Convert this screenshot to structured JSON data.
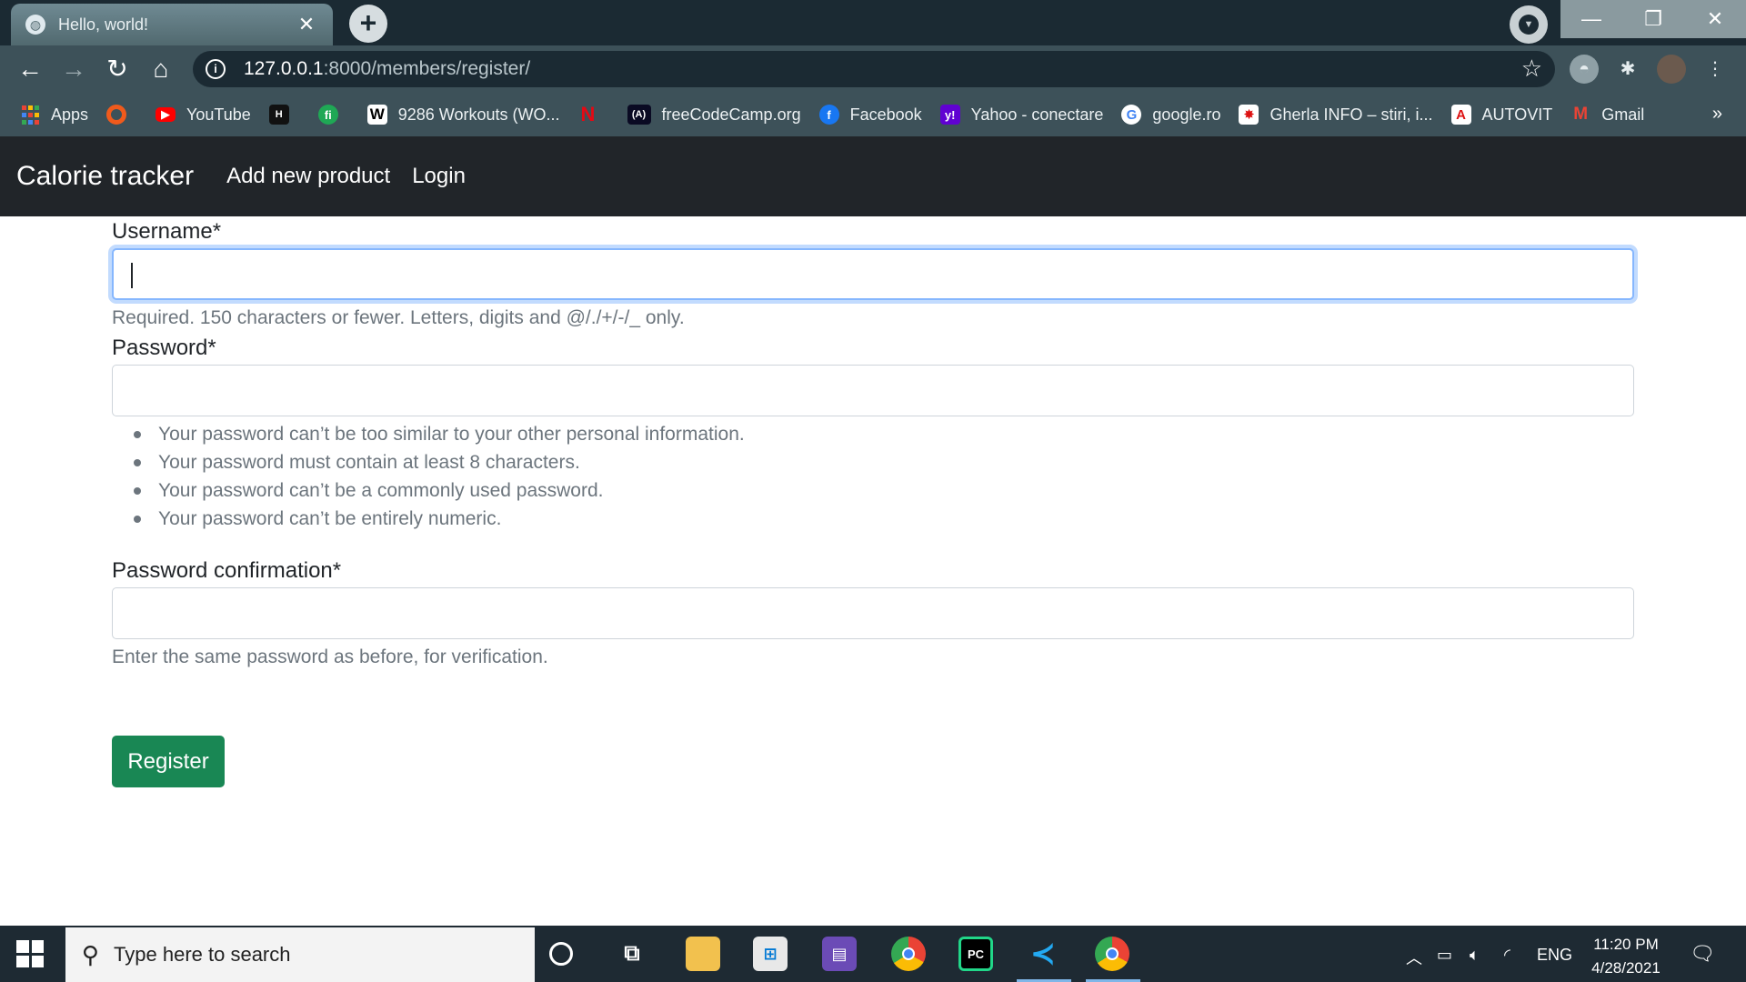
{
  "browser": {
    "tab_title": "Hello, world!",
    "tab_close": "✕",
    "new_tab": "+",
    "url_host": "127.0.0.1",
    "url_path": ":8000/members/register/",
    "window_controls": {
      "minimize": "—",
      "restore": "❐",
      "close": "✕"
    },
    "bookmarks": [
      {
        "label": "Apps",
        "icon": "apps-grid-icon"
      },
      {
        "label": "",
        "icon": "orange-ring-icon"
      },
      {
        "label": "YouTube",
        "icon": "youtube-icon"
      },
      {
        "label": "",
        "icon": "hackerrank-icon"
      },
      {
        "label": "",
        "icon": "fi-icon"
      },
      {
        "label": "9286 Workouts (WO...",
        "icon": "w-icon"
      },
      {
        "label": "",
        "icon": "netflix-icon"
      },
      {
        "label": "freeCodeCamp.org",
        "icon": "freecodecamp-icon"
      },
      {
        "label": "Facebook",
        "icon": "facebook-icon"
      },
      {
        "label": "Yahoo - conectare",
        "icon": "yahoo-icon"
      },
      {
        "label": "google.ro",
        "icon": "google-icon"
      },
      {
        "label": "Gherla INFO – stiri, i...",
        "icon": "gherla-icon"
      },
      {
        "label": "AUTOVIT",
        "icon": "autovit-icon"
      },
      {
        "label": "Gmail",
        "icon": "gmail-icon"
      }
    ],
    "bookmarks_more": "»"
  },
  "app": {
    "brand": "Calorie tracker",
    "nav": {
      "add_product": "Add new product",
      "login": "Login"
    }
  },
  "form": {
    "username_label": "Username*",
    "username_value": "",
    "username_help": "Required. 150 characters or fewer. Letters, digits and @/./+/-/_ only.",
    "password_label": "Password*",
    "password_value": "",
    "password_rules": [
      "Your password can’t be too similar to your other personal information.",
      "Your password must contain at least 8 characters.",
      "Your password can’t be a commonly used password.",
      "Your password can’t be entirely numeric."
    ],
    "confirm_label": "Password confirmation*",
    "confirm_value": "",
    "confirm_help": "Enter the same password as before, for verification.",
    "submit": "Register"
  },
  "taskbar": {
    "search_placeholder": "Type here to search",
    "language": "ENG",
    "time": "11:20 PM",
    "date": "4/28/2021"
  },
  "colors": {
    "navbar_bg": "#212529",
    "register_button": "#198754",
    "focus_ring": "#86b7fe",
    "browser_frame": "#3d5159"
  }
}
